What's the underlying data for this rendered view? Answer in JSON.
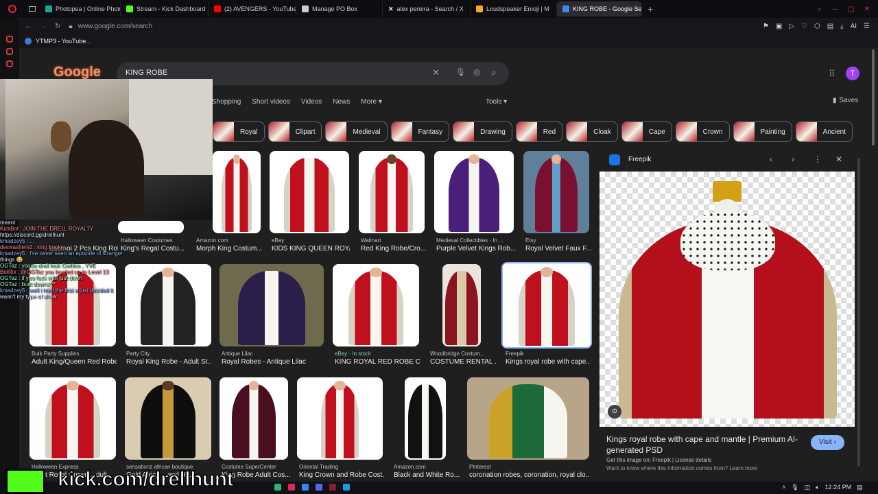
{
  "browser": {
    "tabs": [
      {
        "label": "Photopea | Online Photo E",
        "color": "#18a497"
      },
      {
        "label": "Stream - Kick Dashboard",
        "color": "#53fc18"
      },
      {
        "label": "(2) AVENGERS - YouTube",
        "color": "#ff0000"
      },
      {
        "label": "Manage PO Box",
        "color": "#cccccc"
      },
      {
        "label": "alex pereira - Search / X",
        "color": "#ffffff"
      },
      {
        "label": "Loudspeaker Emoji | M",
        "color": "#f9a825"
      },
      {
        "label": "KING ROBE - Google Sear",
        "color": "#4285f4"
      }
    ],
    "url": "www.google.com/search",
    "bookmark": "YTMP3 - YouTube...",
    "new_tab": "+"
  },
  "google": {
    "logo": "Google",
    "query": "KING ROBE",
    "avatar": "T",
    "tabs": [
      "Shopping",
      "Short videos",
      "Videos",
      "News",
      "More ▾"
    ],
    "tools": "Tools ▾",
    "saves": "Saves",
    "chips": [
      "Royal",
      "Clipart",
      "Medieval",
      "Fantasy",
      "Drawing",
      "Red",
      "Cloak",
      "Cape",
      "Crown",
      "Painting",
      "Ancient"
    ],
    "row1": [
      {
        "src": "Halloween Costumes",
        "title": "King's Regal Costu..."
      },
      {
        "src": "Amazon.com",
        "title": "Morph King Costum..."
      },
      {
        "src": "eBay",
        "title": "KIDS KING QUEEN ROYA..."
      },
      {
        "src": "Walmart",
        "title": "Red King Robe/Cro..."
      },
      {
        "src": "Medieval Collectibles · In ...",
        "title": "Purple Velvet Kings Rob..."
      },
      {
        "src": "Etsy",
        "title": "Royal Velvet Faux F..."
      }
    ],
    "row2": [
      {
        "src": "Bulk Party Supplies",
        "title": "Adult King/Queen Red Robe"
      },
      {
        "src": "Party City",
        "title": "Royal King Robe - Adult St..."
      },
      {
        "src": "Antique Lilac",
        "title": "Royal Robes - Antique Lilac"
      },
      {
        "src": "eBay · In stock",
        "title": "KING ROYAL RED ROBE C..."
      },
      {
        "src": "Woodbridge Costum...",
        "title": "COSTUME RENTAL ..."
      },
      {
        "src": "Freepik",
        "title": "Kings royal robe with cape..."
      }
    ],
    "row3": [
      {
        "src": "Halloween Express",
        "title": "Adult Royal Crown ...dult"
      },
      {
        "src": "sensationz african boutique",
        "title": "Gold Africa ...and H..."
      },
      {
        "src": "Costume SuperCenter",
        "title": "King Robe Adult Cos..."
      },
      {
        "src": "Oriental Trading",
        "title": "King Crown and Robe Cost..."
      },
      {
        "src": "Amazon.com",
        "title": "Black and White Ro..."
      },
      {
        "src": "Pinterest",
        "title": "coronation robes, coronation, royal clo..."
      }
    ],
    "row0_partial": {
      "title": "Laumoi 2 Pcs King Robe..."
    },
    "panel": {
      "source": "Freepik",
      "title": "Kings royal robe with cape and mantle | Premium AI-generated PSD",
      "visit": "Visit ›",
      "get_image": "Get this image on: Freepik | License details",
      "want": "Want to know where this information comes from? Learn more"
    }
  },
  "overlay": {
    "kick": "kick.com/drellhunt",
    "chat": [
      "meant",
      "KickBot : JOIN THE DRELL ROYALTY",
      "https://discord.gg/drellhunt",
      "kmadzey5 : ...",
      "deswashere2 : king booker",
      "kmadzey5 : I've never seen an episode of stranger",
      "things 😂",
      "OGTaz : yoooo drell look Carlitos , YVE",
      "BotRix : @OGTaz you leveled up to Level 13",
      "OGTaz : if you fuck with just down",
      "OGTaz : bust downs***",
      "kmadzey5 : well i tried the first a just decided it",
      "wasn't my type of show"
    ]
  },
  "taskbar": {
    "time": "12:24 PM"
  }
}
